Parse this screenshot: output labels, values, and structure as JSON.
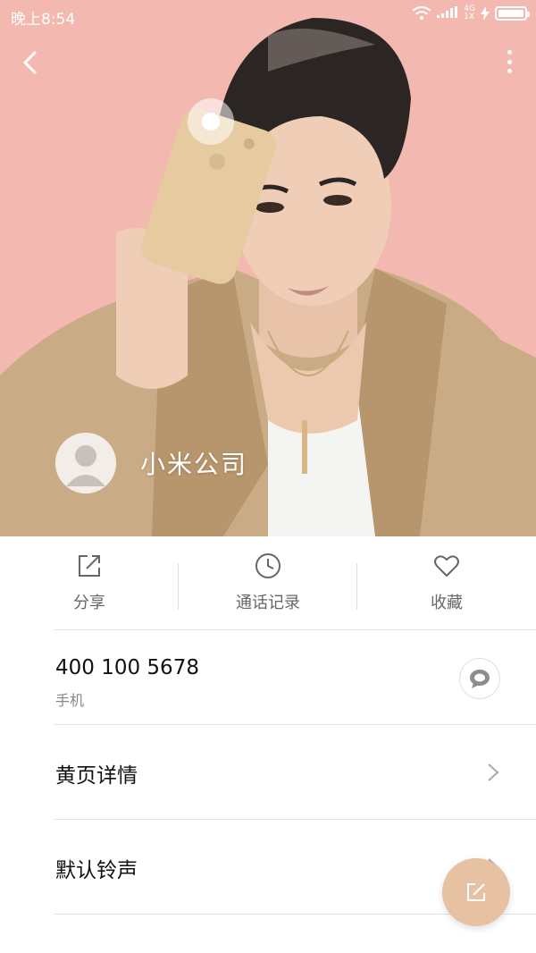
{
  "status_bar": {
    "time": "晚上8:54",
    "network_top": "4G",
    "network_bottom": "1X"
  },
  "header": {
    "contact_name": "小米公司",
    "icons": {
      "back": "back-arrow-icon",
      "more": "more-vertical-icon",
      "avatar": "default-avatar-icon"
    }
  },
  "actions": [
    {
      "label": "分享",
      "icon": "share-icon"
    },
    {
      "label": "通话记录",
      "icon": "clock-icon"
    },
    {
      "label": "收藏",
      "icon": "heart-icon"
    }
  ],
  "phone": {
    "number": "400 100 5678",
    "type": "手机",
    "icon": "message-icon"
  },
  "list": [
    {
      "title": "黄页详情"
    },
    {
      "title": "默认铃声"
    }
  ],
  "fab": {
    "icon": "edit-icon"
  },
  "colors": {
    "hero_bg": "#f3b9b1",
    "fab_bg": "#e6c2a2"
  }
}
